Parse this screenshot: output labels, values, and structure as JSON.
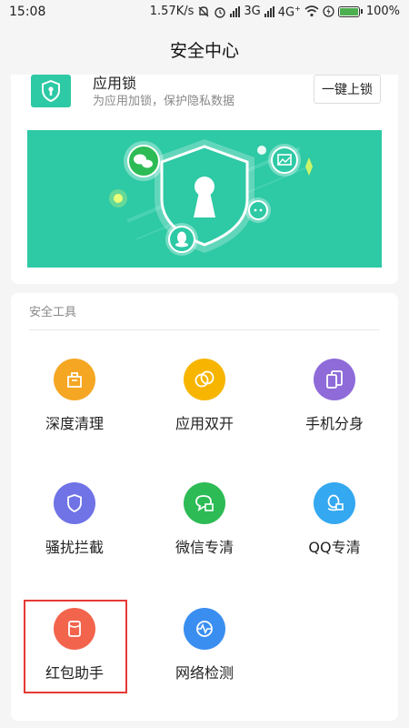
{
  "status_bar": {
    "time": "15:08",
    "speed": "1.57K/s",
    "network1": "3G",
    "network2": "4G",
    "network2_suffix": "+",
    "battery": "100%",
    "battery_level": 1.0,
    "icons": [
      "mute-icon",
      "alarm-icon",
      "signal-icon",
      "wifi-icon",
      "charging-icon",
      "battery-icon"
    ]
  },
  "header": {
    "title": "安全中心"
  },
  "app_lock": {
    "title": "应用锁",
    "subtitle": "为应用加锁，保护隐私数据",
    "button": "一键上锁",
    "icon": "shield-lock-icon"
  },
  "banner": {
    "color": "#2ec9a5",
    "icons": [
      "wechat-icon",
      "photo-icon",
      "chat-icon",
      "qq-icon",
      "keyhole-icon"
    ]
  },
  "tools": {
    "section_title": "安全工具",
    "items": [
      {
        "label": "深度清理",
        "icon": "clean-bag-icon",
        "color": "#f5a623"
      },
      {
        "label": "应用双开",
        "icon": "dual-circle-icon",
        "color": "#f7b500"
      },
      {
        "label": "手机分身",
        "icon": "phone-clone-icon",
        "color": "#8e6bd9"
      },
      {
        "label": "骚扰拦截",
        "icon": "shield-icon",
        "color": "#6f73e6"
      },
      {
        "label": "微信专清",
        "icon": "wechat-clean-icon",
        "color": "#2dbb55"
      },
      {
        "label": "QQ专清",
        "icon": "qq-clean-icon",
        "color": "#34a8f0"
      },
      {
        "label": "红包助手",
        "icon": "red-packet-icon",
        "color": "#f2644c"
      },
      {
        "label": "网络检测",
        "icon": "network-pulse-icon",
        "color": "#3a8ef0"
      }
    ]
  }
}
